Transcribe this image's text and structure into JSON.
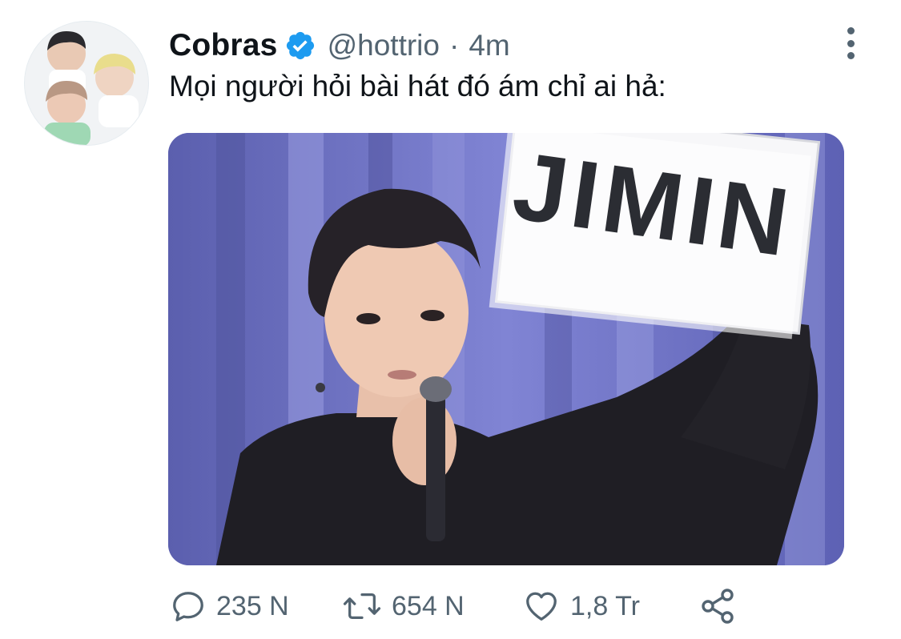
{
  "tweet": {
    "display_name": "Cobras",
    "handle": "@hottrio",
    "separator": "·",
    "time": "4m",
    "text": "Mọi người hỏi bài hát đó ám chỉ ai hả:",
    "media": {
      "sign_text": "JIMIN"
    }
  },
  "actions": {
    "reply_count": "235 N",
    "retweet_count": "654 N",
    "like_count": "1,8 Tr"
  },
  "colors": {
    "verified": "#1d9bf0",
    "secondary_text": "#536471",
    "primary_text": "#0f1419"
  },
  "icons": {
    "more": "more-vertical-icon",
    "reply": "reply-icon",
    "retweet": "retweet-icon",
    "like": "heart-icon",
    "share": "share-icon",
    "verified": "verified-badge-icon"
  }
}
